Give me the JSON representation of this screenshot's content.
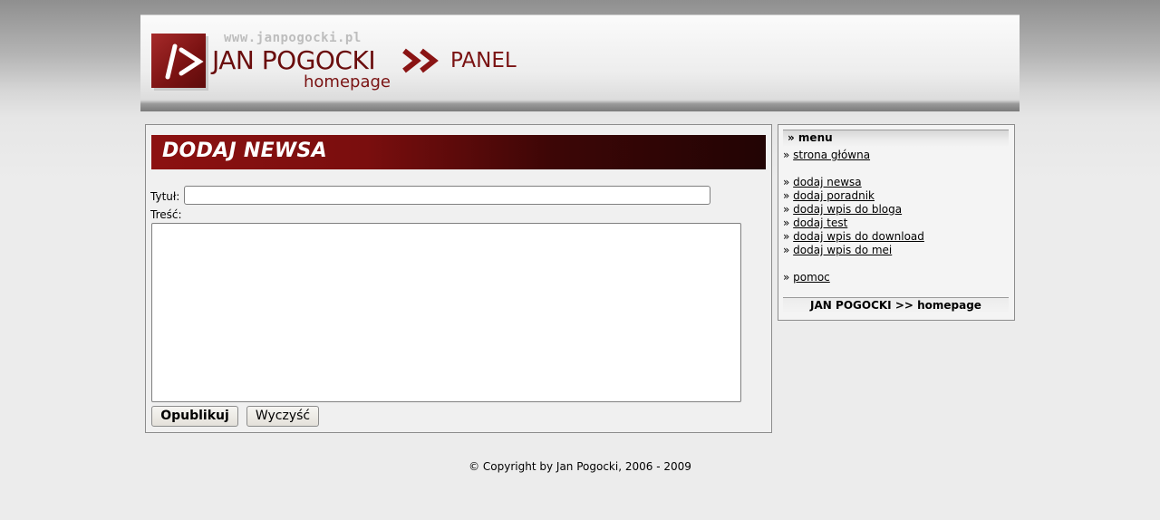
{
  "header": {
    "url_text": "www.janpogocki.pl",
    "name": "JAN POGOCKI",
    "subtitle": "homepage",
    "arrows": ">>",
    "section": "PANEL"
  },
  "form": {
    "heading": "DODAJ NEWSA",
    "title_label": "Tytuł:",
    "title_value": "",
    "content_label": "Treść:",
    "content_value": "",
    "submit_label": "Opublikuj",
    "clear_label": "Wyczyść"
  },
  "sidebar": {
    "heading": "» menu",
    "bullet": "»",
    "items": [
      {
        "label": "strona główna"
      },
      {
        "label": "dodaj newsa"
      },
      {
        "label": "dodaj poradnik"
      },
      {
        "label": "dodaj wpis do bloga"
      },
      {
        "label": "dodaj test"
      },
      {
        "label": "dodaj wpis do download"
      },
      {
        "label": "dodaj wpis do mei"
      },
      {
        "label": "pomoc"
      }
    ],
    "footer": "JAN POGOCKI >> homepage"
  },
  "footer": {
    "copyright": "© Copyright by Jan Pogocki, 2006 - 2009"
  },
  "colors": {
    "brand": "#7a1212",
    "title_bar_start": "#8c1111",
    "title_bar_end": "#220404"
  }
}
